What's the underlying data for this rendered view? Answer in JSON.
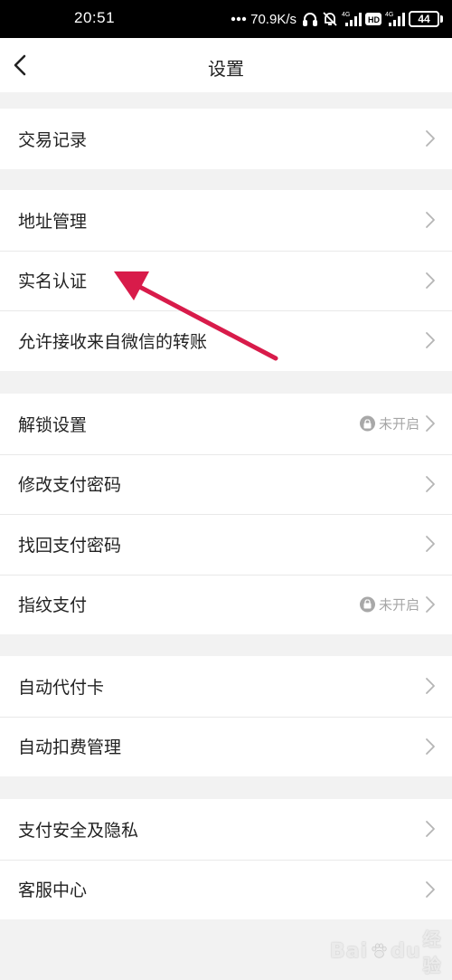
{
  "status_bar": {
    "time": "20:51",
    "net_speed": "70.9K/s",
    "battery": "44",
    "icons": [
      "headphones-icon",
      "mute-bell-icon",
      "signal-4g-icon",
      "hd-icon",
      "signal-4g-icon-2"
    ]
  },
  "header": {
    "title": "设置",
    "back_icon": "chevron-left-icon"
  },
  "groups": [
    {
      "items": [
        {
          "label": "交易记录"
        }
      ]
    },
    {
      "items": [
        {
          "label": "地址管理"
        },
        {
          "label": "实名认证"
        },
        {
          "label": "允许接收来自微信的转账"
        }
      ]
    },
    {
      "items": [
        {
          "label": "解锁设置",
          "status": "未开启",
          "status_icon": "lock-icon"
        },
        {
          "label": "修改支付密码"
        },
        {
          "label": "找回支付密码"
        },
        {
          "label": "指纹支付",
          "status": "未开启",
          "status_icon": "lock-icon"
        }
      ]
    },
    {
      "items": [
        {
          "label": "自动代付卡"
        },
        {
          "label": "自动扣费管理"
        }
      ]
    },
    {
      "items": [
        {
          "label": "支付安全及隐私"
        },
        {
          "label": "客服中心"
        }
      ]
    }
  ],
  "annotation": {
    "color": "#d81b4a"
  },
  "watermark": {
    "text": "Bai",
    "text2": "du",
    "sub": "经验"
  },
  "colors": {
    "page_bg": "#f2f2f2",
    "row_bg": "#ffffff",
    "divider": "#e9e9e9",
    "muted": "#a6a6a6"
  }
}
